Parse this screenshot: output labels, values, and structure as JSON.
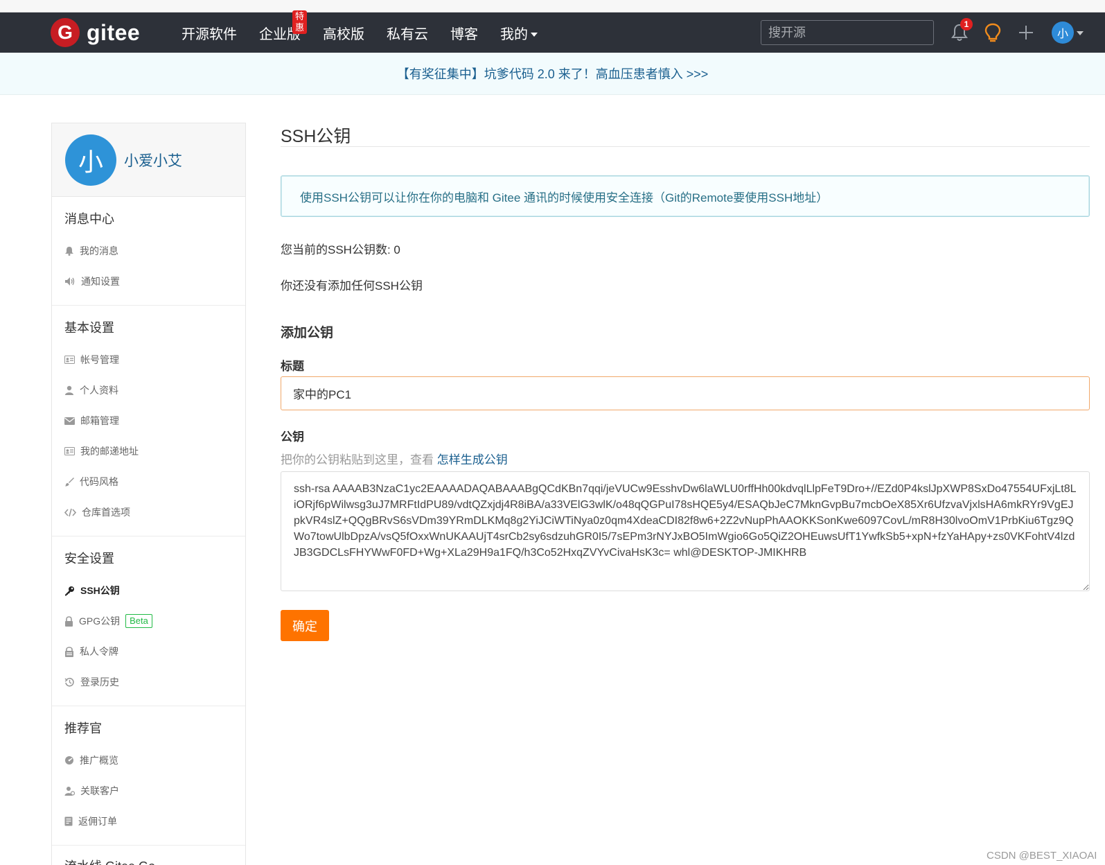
{
  "navbar": {
    "logo_mark": "G",
    "logo_text": "gitee",
    "links": [
      {
        "label": "开源软件"
      },
      {
        "label": "企业版",
        "badge": "特惠"
      },
      {
        "label": "高校版"
      },
      {
        "label": "私有云"
      },
      {
        "label": "博客"
      },
      {
        "label": "我的"
      }
    ],
    "search_placeholder": "搜开源",
    "notification_count": "1",
    "avatar_char": "小"
  },
  "announcement": {
    "text": "【有奖征集中】坑爹代码 2.0 来了！高血压患者慎入 >>>"
  },
  "sidebar": {
    "profile": {
      "avatar_char": "小",
      "name": "小爱小艾"
    },
    "sections": [
      {
        "title": "消息中心",
        "items": [
          {
            "label": "我的消息",
            "icon": "bell-icon"
          },
          {
            "label": "通知设置",
            "icon": "speaker-icon"
          }
        ]
      },
      {
        "title": "基本设置",
        "items": [
          {
            "label": "帐号管理",
            "icon": "id-card-icon"
          },
          {
            "label": "个人资料",
            "icon": "user-icon"
          },
          {
            "label": "邮箱管理",
            "icon": "envelope-icon"
          },
          {
            "label": "我的邮递地址",
            "icon": "address-card-icon"
          },
          {
            "label": "代码风格",
            "icon": "brush-icon"
          },
          {
            "label": "仓库首选项",
            "icon": "code-icon"
          }
        ]
      },
      {
        "title": "安全设置",
        "items": [
          {
            "label": "SSH公钥",
            "icon": "key-icon",
            "active": true
          },
          {
            "label": "GPG公钥",
            "icon": "lock-icon",
            "badge": "Beta"
          },
          {
            "label": "私人令牌",
            "icon": "token-icon"
          },
          {
            "label": "登录历史",
            "icon": "history-icon"
          }
        ]
      },
      {
        "title": "推荐官",
        "items": [
          {
            "label": "推广概览",
            "icon": "gauge-icon"
          },
          {
            "label": "关联客户",
            "icon": "user-link-icon"
          },
          {
            "label": "返佣订单",
            "icon": "order-icon"
          }
        ]
      }
    ],
    "partial_next_section": "流水线 Gitee Go"
  },
  "main": {
    "title": "SSH公钥",
    "info": "使用SSH公钥可以让你在你的电脑和 Gitee 通讯的时候使用安全连接（Git的Remote要使用SSH地址）",
    "count_line": "您当前的SSH公钥数: 0",
    "empty_line": "你还没有添加任何SSH公钥",
    "add_title": "添加公钥",
    "title_label": "标题",
    "title_value": "家中的PC1",
    "key_label": "公钥",
    "hint_text": "把你的公钥粘贴到这里，查看",
    "hint_link": "怎样生成公钥",
    "key_value": "ssh-rsa AAAAB3NzaC1yc2EAAAADAQABAAABgQCdKBn7qqi/jeVUCw9EsshvDw6laWLU0rffHh00kdvqlLlpFeT9Dro+//EZd0P4kslJpXWP8SxDo47554UFxjLt8LiORjf6pWilwsg3uJ7MRFtIdPU89/vdtQZxjdj4R8iBA/a33VElG3wlK/o48qQGPuI78sHQE5y4/ESAQbJeC7MknGvpBu7mcbOeX85Xr6UfzvaVjxlsHA6mkRYr9VgEJpkVR4slZ+QQgBRvS6sVDm39YRmDLKMq8g2YiJCiWTiNya0z0qm4XdeaCDI82f8w6+2Z2vNupPhAAOKKSonKwe6097CovL/mR8H30lvoOmV1PrbKiu6Tgz9QWo7towUlbDpzA/vsQ5fOxxWnUKAAUjT4srCb2sy6sdzuhGR0I5/7sEPm3rNYJxBO5ImWgio6Go5QiZ2OHEuwsUfT1YwfkSb5+xpN+fzYaHApy+zs0VKFohtV4lzdJB3GDCLsFHYWwF0FD+Wg+XLa29H9a1FQ/h3Co52HxqZVYvCivaHsK3c= whl@DESKTOP-JMIKHRB",
    "submit_label": "确定"
  },
  "watermark": "CSDN @BEST_XIAOAI",
  "colors": {
    "navbar_bg": "#2d3139",
    "accent_orange": "#fe7300",
    "link_blue": "#1a5f8f",
    "badge_red": "#e02020",
    "beta_green": "#21ba45"
  }
}
